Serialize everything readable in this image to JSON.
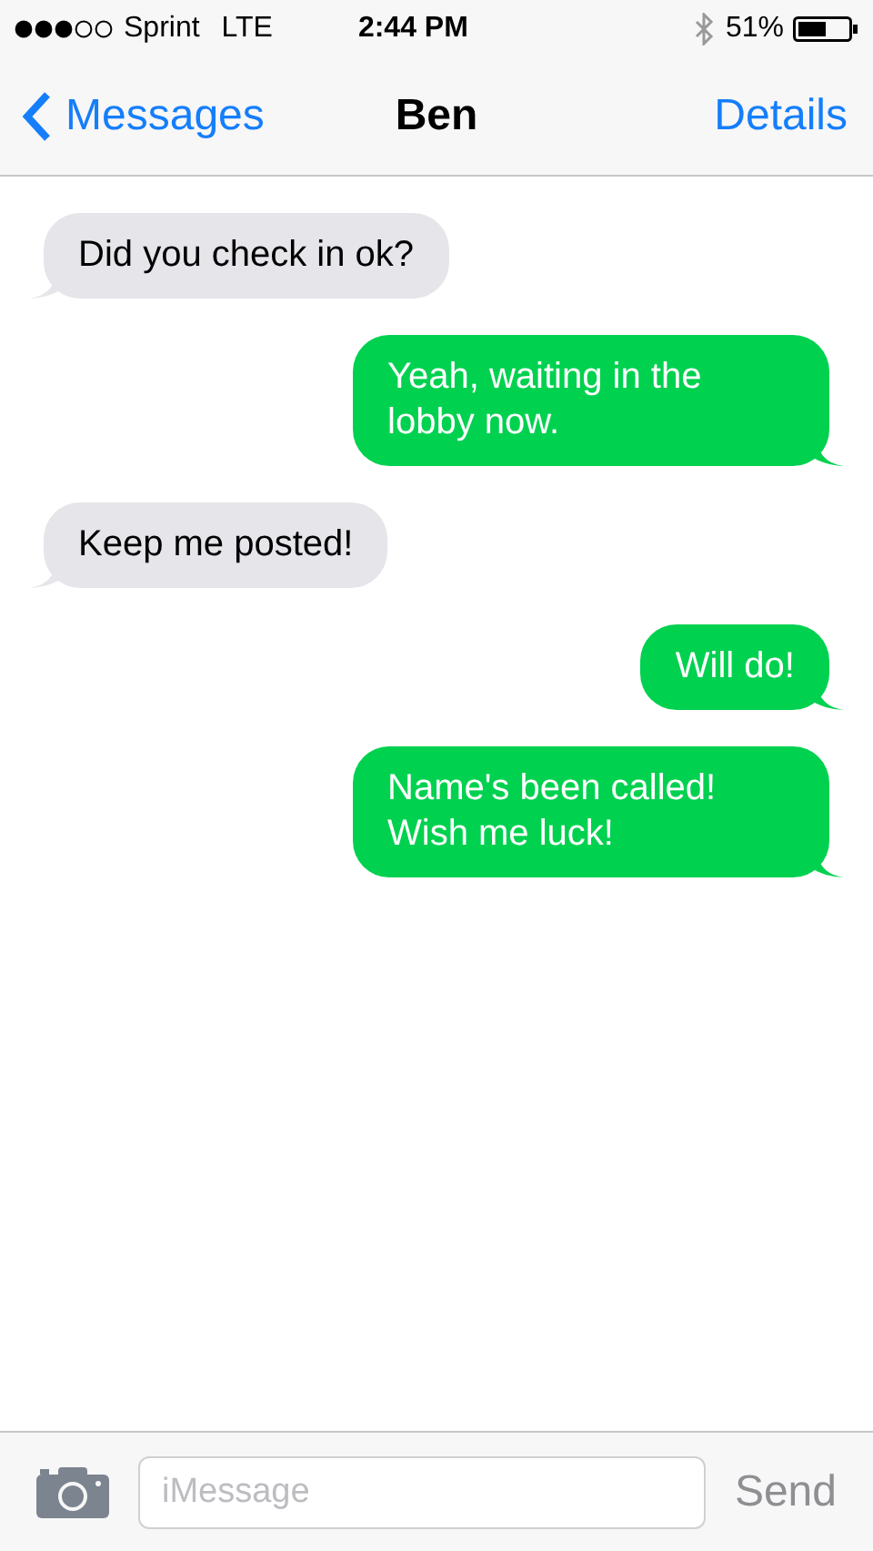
{
  "status_bar": {
    "carrier": "Sprint",
    "network": "LTE",
    "time": "2:44 PM",
    "battery": "51%"
  },
  "nav": {
    "back": "Messages",
    "title": "Ben",
    "action": "Details"
  },
  "messages": [
    {
      "kind": "received",
      "text": "Did you check in ok?"
    },
    {
      "kind": "sent",
      "text": "Yeah, waiting in the lobby now."
    },
    {
      "kind": "received",
      "text": "Keep me posted!"
    },
    {
      "kind": "sent",
      "text": "Will do!"
    },
    {
      "kind": "sent",
      "text": "Name's been called! Wish me luck!"
    }
  ],
  "composer": {
    "placeholder": "iMessage",
    "send": "Send",
    "send_disabled": true
  }
}
